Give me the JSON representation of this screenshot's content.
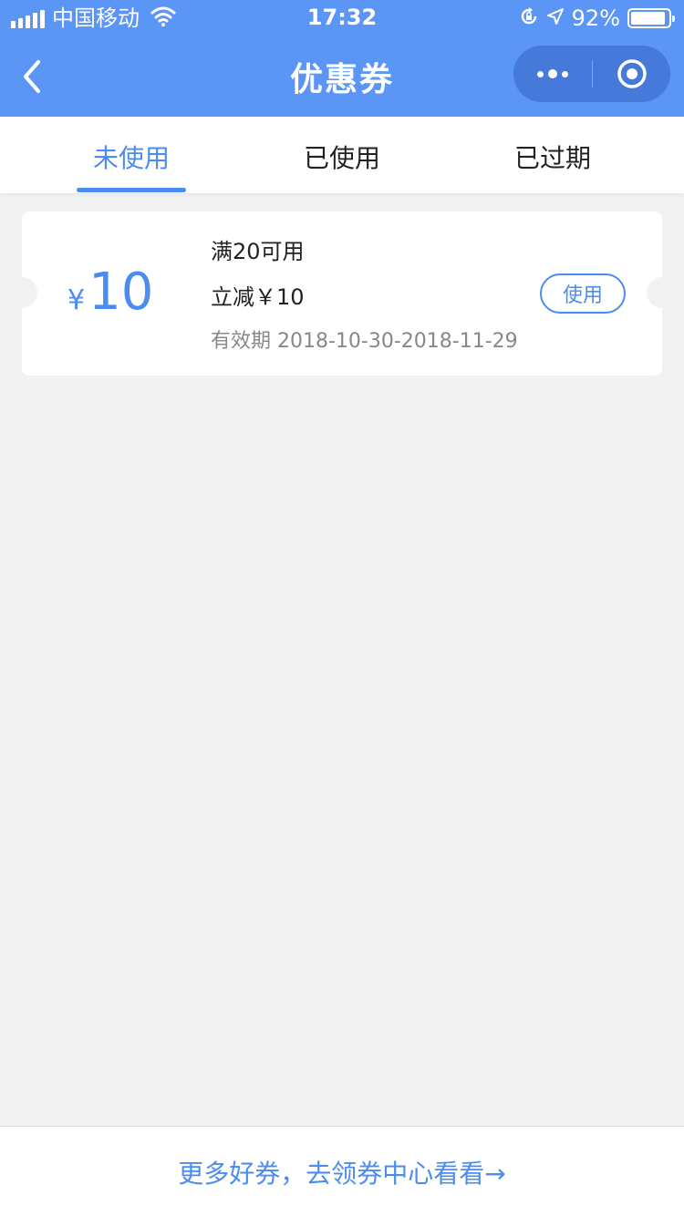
{
  "status_bar": {
    "carrier": "中国移动",
    "time": "17:32",
    "battery_percent": "92%",
    "battery_level": 0.92,
    "icons": [
      "signal-icon",
      "wifi-icon",
      "rotation-lock-icon",
      "location-icon",
      "battery-icon"
    ]
  },
  "nav": {
    "title": "优惠券",
    "icons": [
      "back-icon",
      "more-icon",
      "close-circle-icon"
    ]
  },
  "tabs": [
    {
      "label": "未使用",
      "active": true
    },
    {
      "label": "已使用",
      "active": false
    },
    {
      "label": "已过期",
      "active": false
    }
  ],
  "coupons": [
    {
      "currency": "¥",
      "amount": "10",
      "condition": "满20可用",
      "description": "立减￥10",
      "validity": "有效期 2018-10-30-2018-11-29",
      "button": "使用"
    }
  ],
  "footer": {
    "link": "更多好券，去领券中心看看→"
  },
  "colors": {
    "primary": "#5b95f5",
    "accent": "#4b8cf0",
    "background": "#f2f2f2"
  }
}
